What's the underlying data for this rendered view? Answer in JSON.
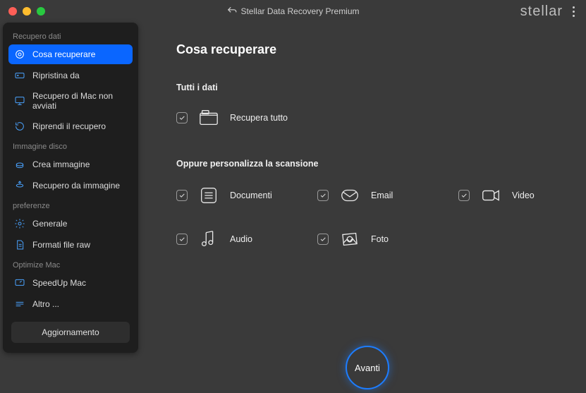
{
  "title": "Stellar Data Recovery Premium",
  "brand": "stellar",
  "sidebar": {
    "groups": [
      {
        "title": "Recupero dati",
        "items": [
          {
            "label": "Cosa recuperare",
            "active": true
          },
          {
            "label": "Ripristina da"
          },
          {
            "label": "Recupero di Mac non avviati"
          },
          {
            "label": "Riprendi il recupero"
          }
        ]
      },
      {
        "title": "Immagine disco",
        "items": [
          {
            "label": "Crea immagine"
          },
          {
            "label": "Recupero da immagine"
          }
        ]
      },
      {
        "title": "preferenze",
        "items": [
          {
            "label": "Generale"
          },
          {
            "label": "Formati file raw"
          }
        ]
      },
      {
        "title": "Optimize Mac",
        "items": [
          {
            "label": "SpeedUp Mac"
          },
          {
            "label": "Altro ..."
          }
        ]
      }
    ],
    "update_label": "Aggiornamento"
  },
  "main": {
    "page_title": "Cosa recuperare",
    "all_heading": "Tutti i dati",
    "recover_all_label": "Recupera tutto",
    "custom_heading": "Oppure personalizza la scansione",
    "options": [
      {
        "label": "Documenti"
      },
      {
        "label": "Email"
      },
      {
        "label": "Video"
      },
      {
        "label": "Audio"
      },
      {
        "label": "Foto"
      }
    ],
    "next_label": "Avanti"
  }
}
